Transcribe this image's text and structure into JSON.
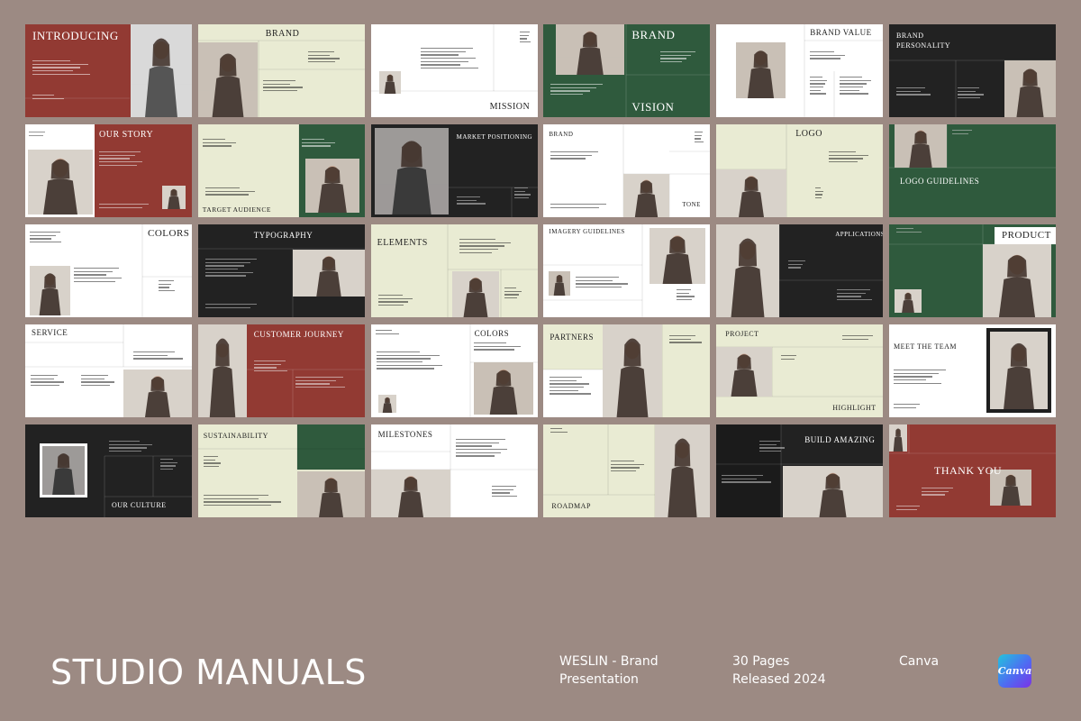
{
  "colors": {
    "background": "#9c8a83",
    "red": "#923a33",
    "green": "#2f5a3d",
    "black": "#222222",
    "beige": "#e9ebd3",
    "white": "#ffffff"
  },
  "slides": [
    {
      "title": "INTRODUCING"
    },
    {
      "title": "BRAND"
    },
    {
      "title": "MISSION"
    },
    {
      "title": "BRAND",
      "title2": "VISION"
    },
    {
      "title": "BRAND VALUE"
    },
    {
      "title": "BRAND",
      "title2": "PERSONALITY"
    },
    {
      "title": "OUR STORY"
    },
    {
      "title": "TARGET AUDIENCE"
    },
    {
      "title": "MARKET POSITIONING"
    },
    {
      "title": "BRAND",
      "title2": "TONE"
    },
    {
      "title": "LOGO"
    },
    {
      "title": "LOGO GUIDELINES"
    },
    {
      "title": "COLORS"
    },
    {
      "title": "TYPOGRAPHY"
    },
    {
      "title": "ELEMENTS"
    },
    {
      "title": "IMAGERY GUIDELINES"
    },
    {
      "title": "APPLICATIONS"
    },
    {
      "title": "PRODUCT"
    },
    {
      "title": "SERVICE"
    },
    {
      "title": "CUSTOMER JOURNEY"
    },
    {
      "title": "COLORS"
    },
    {
      "title": "PARTNERS"
    },
    {
      "title": "PROJECT",
      "title2": "HIGHLIGHT"
    },
    {
      "title": "MEET THE TEAM"
    },
    {
      "title": "OUR CULTURE"
    },
    {
      "title": "SUSTAINABILITY"
    },
    {
      "title": "MILESTONES"
    },
    {
      "title": "ROADMAP"
    },
    {
      "title": "BUILD AMAZING"
    },
    {
      "title": "THANK YOU"
    }
  ],
  "footer": {
    "brand": "STUDIO MANUALS",
    "product_line1": "WESLIN - Brand",
    "product_line2": "Presentation",
    "pages": "30 Pages",
    "released": "Released 2024",
    "platform": "Canva",
    "logo_text": "Canva"
  }
}
